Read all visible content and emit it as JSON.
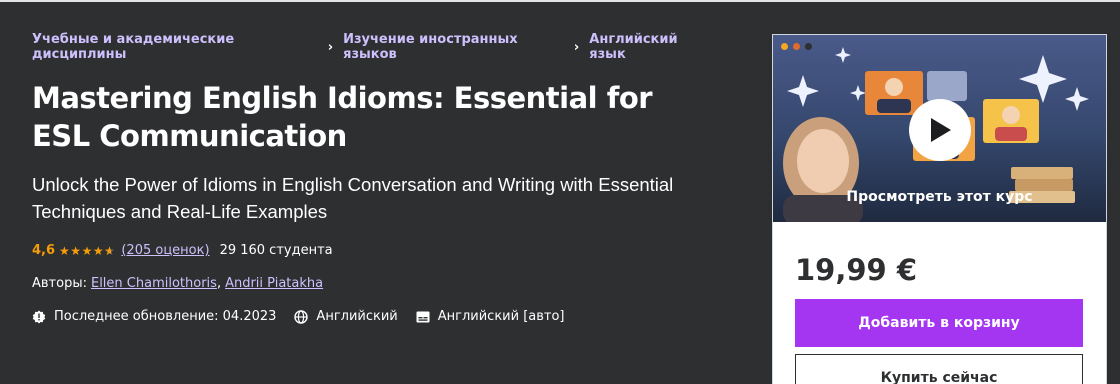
{
  "breadcrumb": [
    "Учебные и академические дисциплины",
    "Изучение иностранных языков",
    "Английский язык"
  ],
  "course": {
    "title": "Mastering English Idioms: Essential for ESL Communication",
    "subtitle": "Unlock the Power of Idioms in English Conversation and Writing with Essential Techniques and Real-Life Examples",
    "rating_value": "4,6",
    "rating_stars": 4.6,
    "rating_count": "(205 оценок)",
    "students": "29 160 студента",
    "authors_label": "Авторы:",
    "authors": [
      "Ellen Chamilothoris",
      "Andrii Piatakha"
    ],
    "last_updated": "Последнее обновление: 04.2023",
    "language": "Английский",
    "captions": "Английский [авто]"
  },
  "sidebar": {
    "preview_label": "Просмотреть этот курс",
    "price": "19,99 €",
    "add_to_cart": "Добавить в корзину",
    "buy_now": "Купить сейчас"
  },
  "colors": {
    "background": "#2d2f31",
    "link": "#cec0fc",
    "rating": "#f69c08",
    "primary_button": "#a435f0"
  },
  "icons": {
    "update": "alert-badge-icon",
    "language": "globe-icon",
    "captions": "closed-captions-icon",
    "play": "play-icon"
  }
}
